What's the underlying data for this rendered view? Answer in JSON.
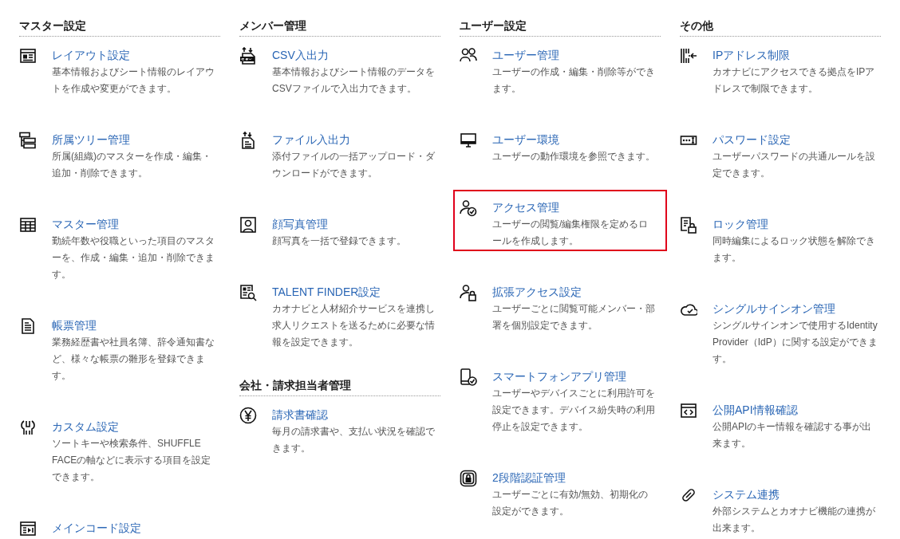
{
  "columns": [
    {
      "sections": [
        {
          "heading": "マスター設定",
          "items": [
            {
              "title": "レイアウト設定",
              "description": "基本情報およびシート情報のレイアウトを作成や変更ができます。",
              "selected": false
            },
            {
              "title": "所属ツリー管理",
              "description": "所属(組織)のマスターを作成・編集・追加・削除できます。",
              "selected": false
            },
            {
              "title": "マスター管理",
              "description": "勤続年数や役職といった項目のマスターを、作成・編集・追加・削除できます。",
              "selected": false
            },
            {
              "title": "帳票管理",
              "description": "業務経歴書や社員名簿、辞令通知書など、様々な帳票の雛形を登録できます。",
              "selected": false
            },
            {
              "title": "カスタム設定",
              "description": "ソートキーや検索条件、SHUFFLE FACEの軸などに表示する項目を設定できます。",
              "selected": false
            },
            {
              "title": "メインコード設定",
              "selected": false
            }
          ]
        }
      ]
    },
    {
      "sections": [
        {
          "heading": "メンバー管理",
          "items": [
            {
              "title": "CSV入出力",
              "description": "基本情報およびシート情報のデータをCSVファイルで入出力できます。",
              "selected": false
            },
            {
              "title": "ファイル入出力",
              "description": "添付ファイルの一括アップロード・ダウンロードができます。",
              "selected": false
            },
            {
              "title": "顔写真管理",
              "description": "顔写真を一括で登録できます。",
              "selected": false
            },
            {
              "title": "TALENT FINDER設定",
              "description": "カオナビと人材紹介サービスを連携し求人リクエストを送るために必要な情報を設定できます。",
              "selected": false
            }
          ]
        },
        {
          "heading": "会社・請求担当者管理",
          "items": [
            {
              "title": "請求書確認",
              "description": "毎月の請求書や、支払い状況を確認できます。",
              "selected": false
            }
          ]
        }
      ]
    },
    {
      "sections": [
        {
          "heading": "ユーザー設定",
          "items": [
            {
              "title": "ユーザー管理",
              "description": "ユーザーの作成・編集・削除等ができます。",
              "selected": false
            },
            {
              "title": "ユーザー環境",
              "description": "ユーザーの動作環境を参照できます。",
              "selected": false
            },
            {
              "title": "アクセス管理",
              "description": "ユーザーの閲覧/編集権限を定めるロールを作成します。",
              "selected": true
            },
            {
              "title": "拡張アクセス設定",
              "description": "ユーザーごとに閲覧可能メンバー・部署を個別設定できます。",
              "selected": false
            },
            {
              "title": "スマートフォンアプリ管理",
              "description": "ユーザーやデバイスごとに利用許可を設定できます。デバイス紛失時の利用停止を設定できます。",
              "selected": false
            },
            {
              "title": "2段階認証管理",
              "description": "ユーザーごとに有効/無効、初期化の設定ができます。",
              "selected": false
            }
          ]
        }
      ]
    },
    {
      "sections": [
        {
          "heading": "その他",
          "items": [
            {
              "title": "IPアドレス制限",
              "description": "カオナビにアクセスできる拠点をIPアドレスで制限できます。",
              "selected": false
            },
            {
              "title": "パスワード設定",
              "description": "ユーザーパスワードの共通ルールを設定できます。",
              "selected": false
            },
            {
              "title": "ロック管理",
              "description": "同時編集によるロック状態を解除できます。",
              "selected": false
            },
            {
              "title": "シングルサインオン管理",
              "description": "シングルサインオンで使用するIdentity Provider（IdP）に関する設定ができます。",
              "selected": false
            },
            {
              "title": "公開API情報確認",
              "description": "公開APIのキー情報を確認する事が出来ます。",
              "selected": false
            },
            {
              "title": "システム連携",
              "description": "外部システムとカオナビ機能の連携が出来ます。",
              "selected": false
            }
          ]
        }
      ]
    }
  ]
}
